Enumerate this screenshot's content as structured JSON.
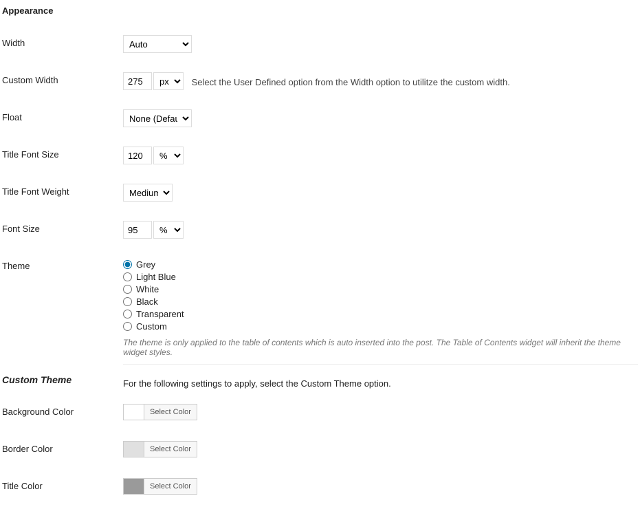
{
  "heading": "Appearance",
  "width": {
    "label": "Width",
    "value": "Auto"
  },
  "custom_width": {
    "label": "Custom Width",
    "value": "275",
    "unit": "px",
    "hint": "Select the User Defined option from the Width option to utilitze the custom width."
  },
  "float": {
    "label": "Float",
    "value": "None (Default)"
  },
  "title_font_size": {
    "label": "Title Font Size",
    "value": "120",
    "unit": "%"
  },
  "title_font_weight": {
    "label": "Title Font Weight",
    "value": "Medium"
  },
  "font_size": {
    "label": "Font Size",
    "value": "95",
    "unit": "%"
  },
  "theme": {
    "label": "Theme",
    "options": {
      "grey": "Grey",
      "light_blue": "Light Blue",
      "white": "White",
      "black": "Black",
      "transparent": "Transparent",
      "custom": "Custom"
    },
    "note": "The theme is only applied to the table of contents which is auto inserted into the post. The Table of Contents widget will inherit the theme widget styles."
  },
  "custom_theme": {
    "heading": "Custom Theme",
    "hint": "For the following settings to apply, select the Custom Theme option."
  },
  "colors": {
    "background": {
      "label": "Background Color",
      "swatch": "#ffffff",
      "button": "Select Color"
    },
    "border": {
      "label": "Border Color",
      "swatch": "#e0e0e0",
      "button": "Select Color"
    },
    "title": {
      "label": "Title Color",
      "swatch": "#9a9a9a",
      "button": "Select Color"
    }
  }
}
